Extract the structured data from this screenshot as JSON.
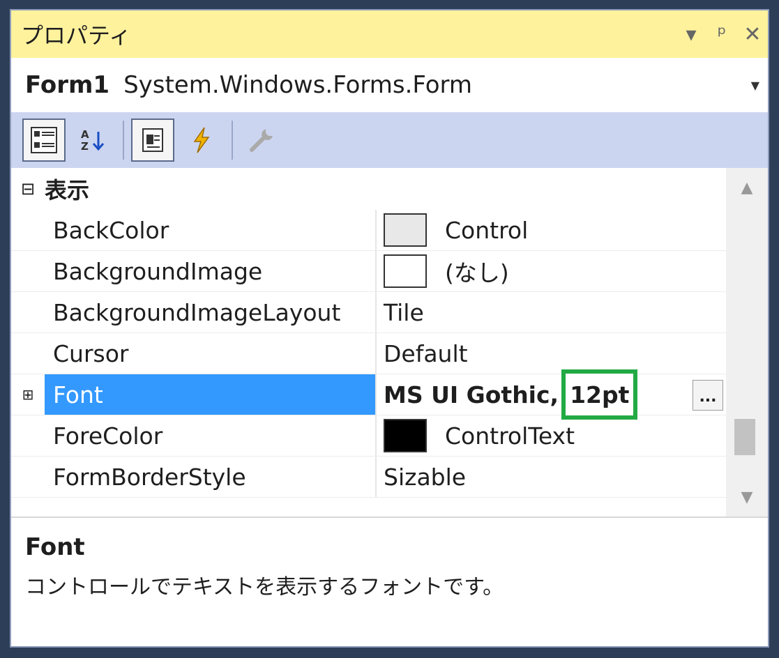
{
  "window": {
    "title": "プロパティ",
    "controls": [
      "▾",
      "ᵖ",
      "✕"
    ]
  },
  "object_selector": {
    "name": "Form1",
    "type": "System.Windows.Forms.Form"
  },
  "toolbar": {
    "icons": [
      "categorized-icon",
      "alphabetical-icon",
      "properties-icon",
      "events-icon",
      "property-pages-icon"
    ]
  },
  "category": {
    "expander": "⊟",
    "title": "表示"
  },
  "properties": [
    {
      "name": "BackColor",
      "value": "Control",
      "swatch": "#e8e8e8"
    },
    {
      "name": "BackgroundImage",
      "value": "(なし)",
      "swatch": "#ffffff"
    },
    {
      "name": "BackgroundImageLayout",
      "value": "Tile"
    },
    {
      "name": "Cursor",
      "value": "Default"
    },
    {
      "name": "Font",
      "value_prefix": "MS UI Gothic,",
      "value_highlight": "12pt",
      "expander": "⊞",
      "selected": true,
      "button": "..."
    },
    {
      "name": "ForeColor",
      "value": "ControlText",
      "swatch": "#000000"
    },
    {
      "name": "FormBorderStyle",
      "value": "Sizable"
    }
  ],
  "description": {
    "title": "Font",
    "text": "コントロールでテキストを表示するフォントです。"
  },
  "colors": {
    "titlebar": "#fff29d",
    "toolbar": "#ccd5f0",
    "selection": "#3399ff",
    "highlight_box": "#22aa44"
  }
}
